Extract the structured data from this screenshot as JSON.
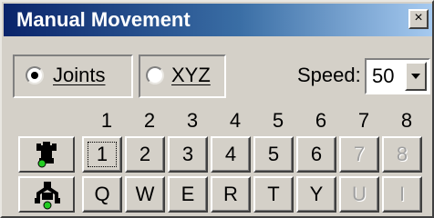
{
  "window": {
    "title": "Manual Movement",
    "close_glyph": "×"
  },
  "mode": {
    "options": [
      {
        "label": "Joints",
        "selected": true
      },
      {
        "label": "XYZ",
        "selected": false
      }
    ]
  },
  "speed": {
    "label": "Speed:",
    "value": "50"
  },
  "columns": [
    "1",
    "2",
    "3",
    "4",
    "5",
    "6",
    "7",
    "8"
  ],
  "rows": [
    {
      "icon": "robot-joint-icon",
      "keys": [
        {
          "label": "1",
          "enabled": true,
          "focused": true
        },
        {
          "label": "2",
          "enabled": true
        },
        {
          "label": "3",
          "enabled": true
        },
        {
          "label": "4",
          "enabled": true
        },
        {
          "label": "5",
          "enabled": true
        },
        {
          "label": "6",
          "enabled": true
        },
        {
          "label": "7",
          "enabled": false
        },
        {
          "label": "8",
          "enabled": false
        }
      ]
    },
    {
      "icon": "robot-gripper-icon",
      "keys": [
        {
          "label": "Q",
          "enabled": true
        },
        {
          "label": "W",
          "enabled": true
        },
        {
          "label": "E",
          "enabled": true
        },
        {
          "label": "R",
          "enabled": true
        },
        {
          "label": "T",
          "enabled": true
        },
        {
          "label": "Y",
          "enabled": true
        },
        {
          "label": "U",
          "enabled": false
        },
        {
          "label": "I",
          "enabled": false
        }
      ]
    }
  ],
  "colors": {
    "title_start": "#0a246a",
    "title_end": "#a6caf0",
    "face": "#d4d0c8",
    "led_green": "#22cc22"
  }
}
